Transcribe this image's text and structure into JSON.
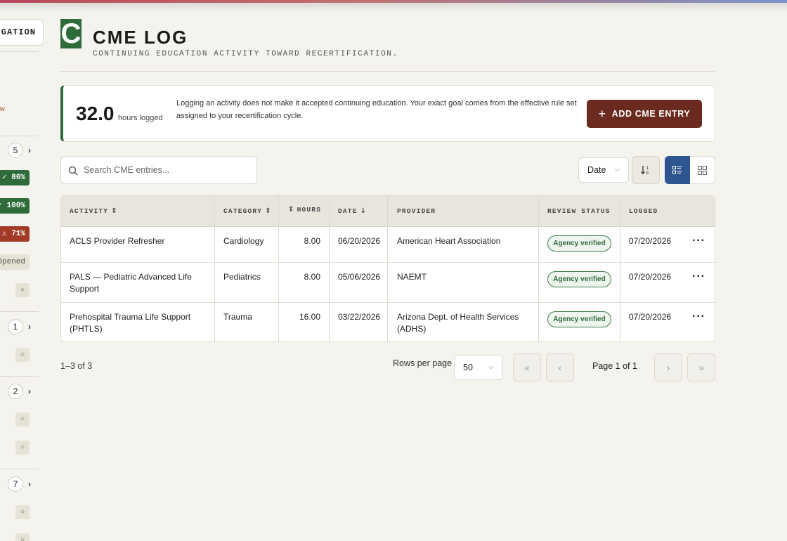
{
  "sidebar": {
    "nav_button_label": "IGATION",
    "red_text": "w",
    "counts": [
      "5",
      "1",
      "2",
      "7"
    ],
    "progress_badges": [
      {
        "label": "✓ 86%",
        "status": "complete",
        "color": "#2e6b3a"
      },
      {
        "label": "✓ 100%",
        "status": "complete",
        "color": "#2e6b3a"
      },
      {
        "label": "⚠ 71%",
        "status": "warning",
        "color": "#a23a25"
      }
    ],
    "opened_label": "Opened"
  },
  "header": {
    "logo_letter": "C",
    "title": "CME LOG",
    "subtitle": "CONTINUING EDUCATION ACTIVITY TOWARD RECERTIFICATION."
  },
  "summary": {
    "hours_value": "32.0",
    "hours_unit": "hours logged",
    "note": "Logging an activity does not make it accepted continuing education. Your exact goal comes from the effective rule set assigned to your recertification cycle.",
    "add_button_label": "ADD CME ENTRY"
  },
  "toolbar": {
    "search_placeholder": "Search CME entries...",
    "sort_field": "Date",
    "active_view": "list"
  },
  "table": {
    "headers": {
      "activity": "ACTIVITY",
      "category": "CATEGORY",
      "hours": "HOURS",
      "date": "DATE",
      "provider": "PROVIDER",
      "review_status": "REVIEW STATUS",
      "logged": "LOGGED"
    },
    "rows": [
      {
        "activity": "ACLS Provider Refresher",
        "category": "Cardiology",
        "hours": "8.00",
        "date": "06/20/2026",
        "provider": "American Heart Association",
        "status": "Agency verified",
        "logged": "07/20/2026"
      },
      {
        "activity": "PALS — Pediatric Advanced Life Support",
        "category": "Pediatrics",
        "hours": "8.00",
        "date": "05/06/2026",
        "provider": "NAEMT",
        "status": "Agency verified",
        "logged": "07/20/2026"
      },
      {
        "activity": "Prehospital Trauma Life Support (PHTLS)",
        "category": "Trauma",
        "hours": "16.00",
        "date": "03/22/2026",
        "provider": "Arizona Dept. of Health Services (ADHS)",
        "status": "Agency verified",
        "logged": "07/20/2026"
      }
    ]
  },
  "pagination": {
    "range_text": "1–3 of 3",
    "rows_per_page_label": "Rows per page",
    "rows_per_page_value": "50",
    "page_text": "Page 1 of 1"
  },
  "colors": {
    "accent_green": "#2e6b3a",
    "primary_button": "#6b2a1f",
    "active_view": "#2d558f",
    "background": "#f4f3ee"
  }
}
